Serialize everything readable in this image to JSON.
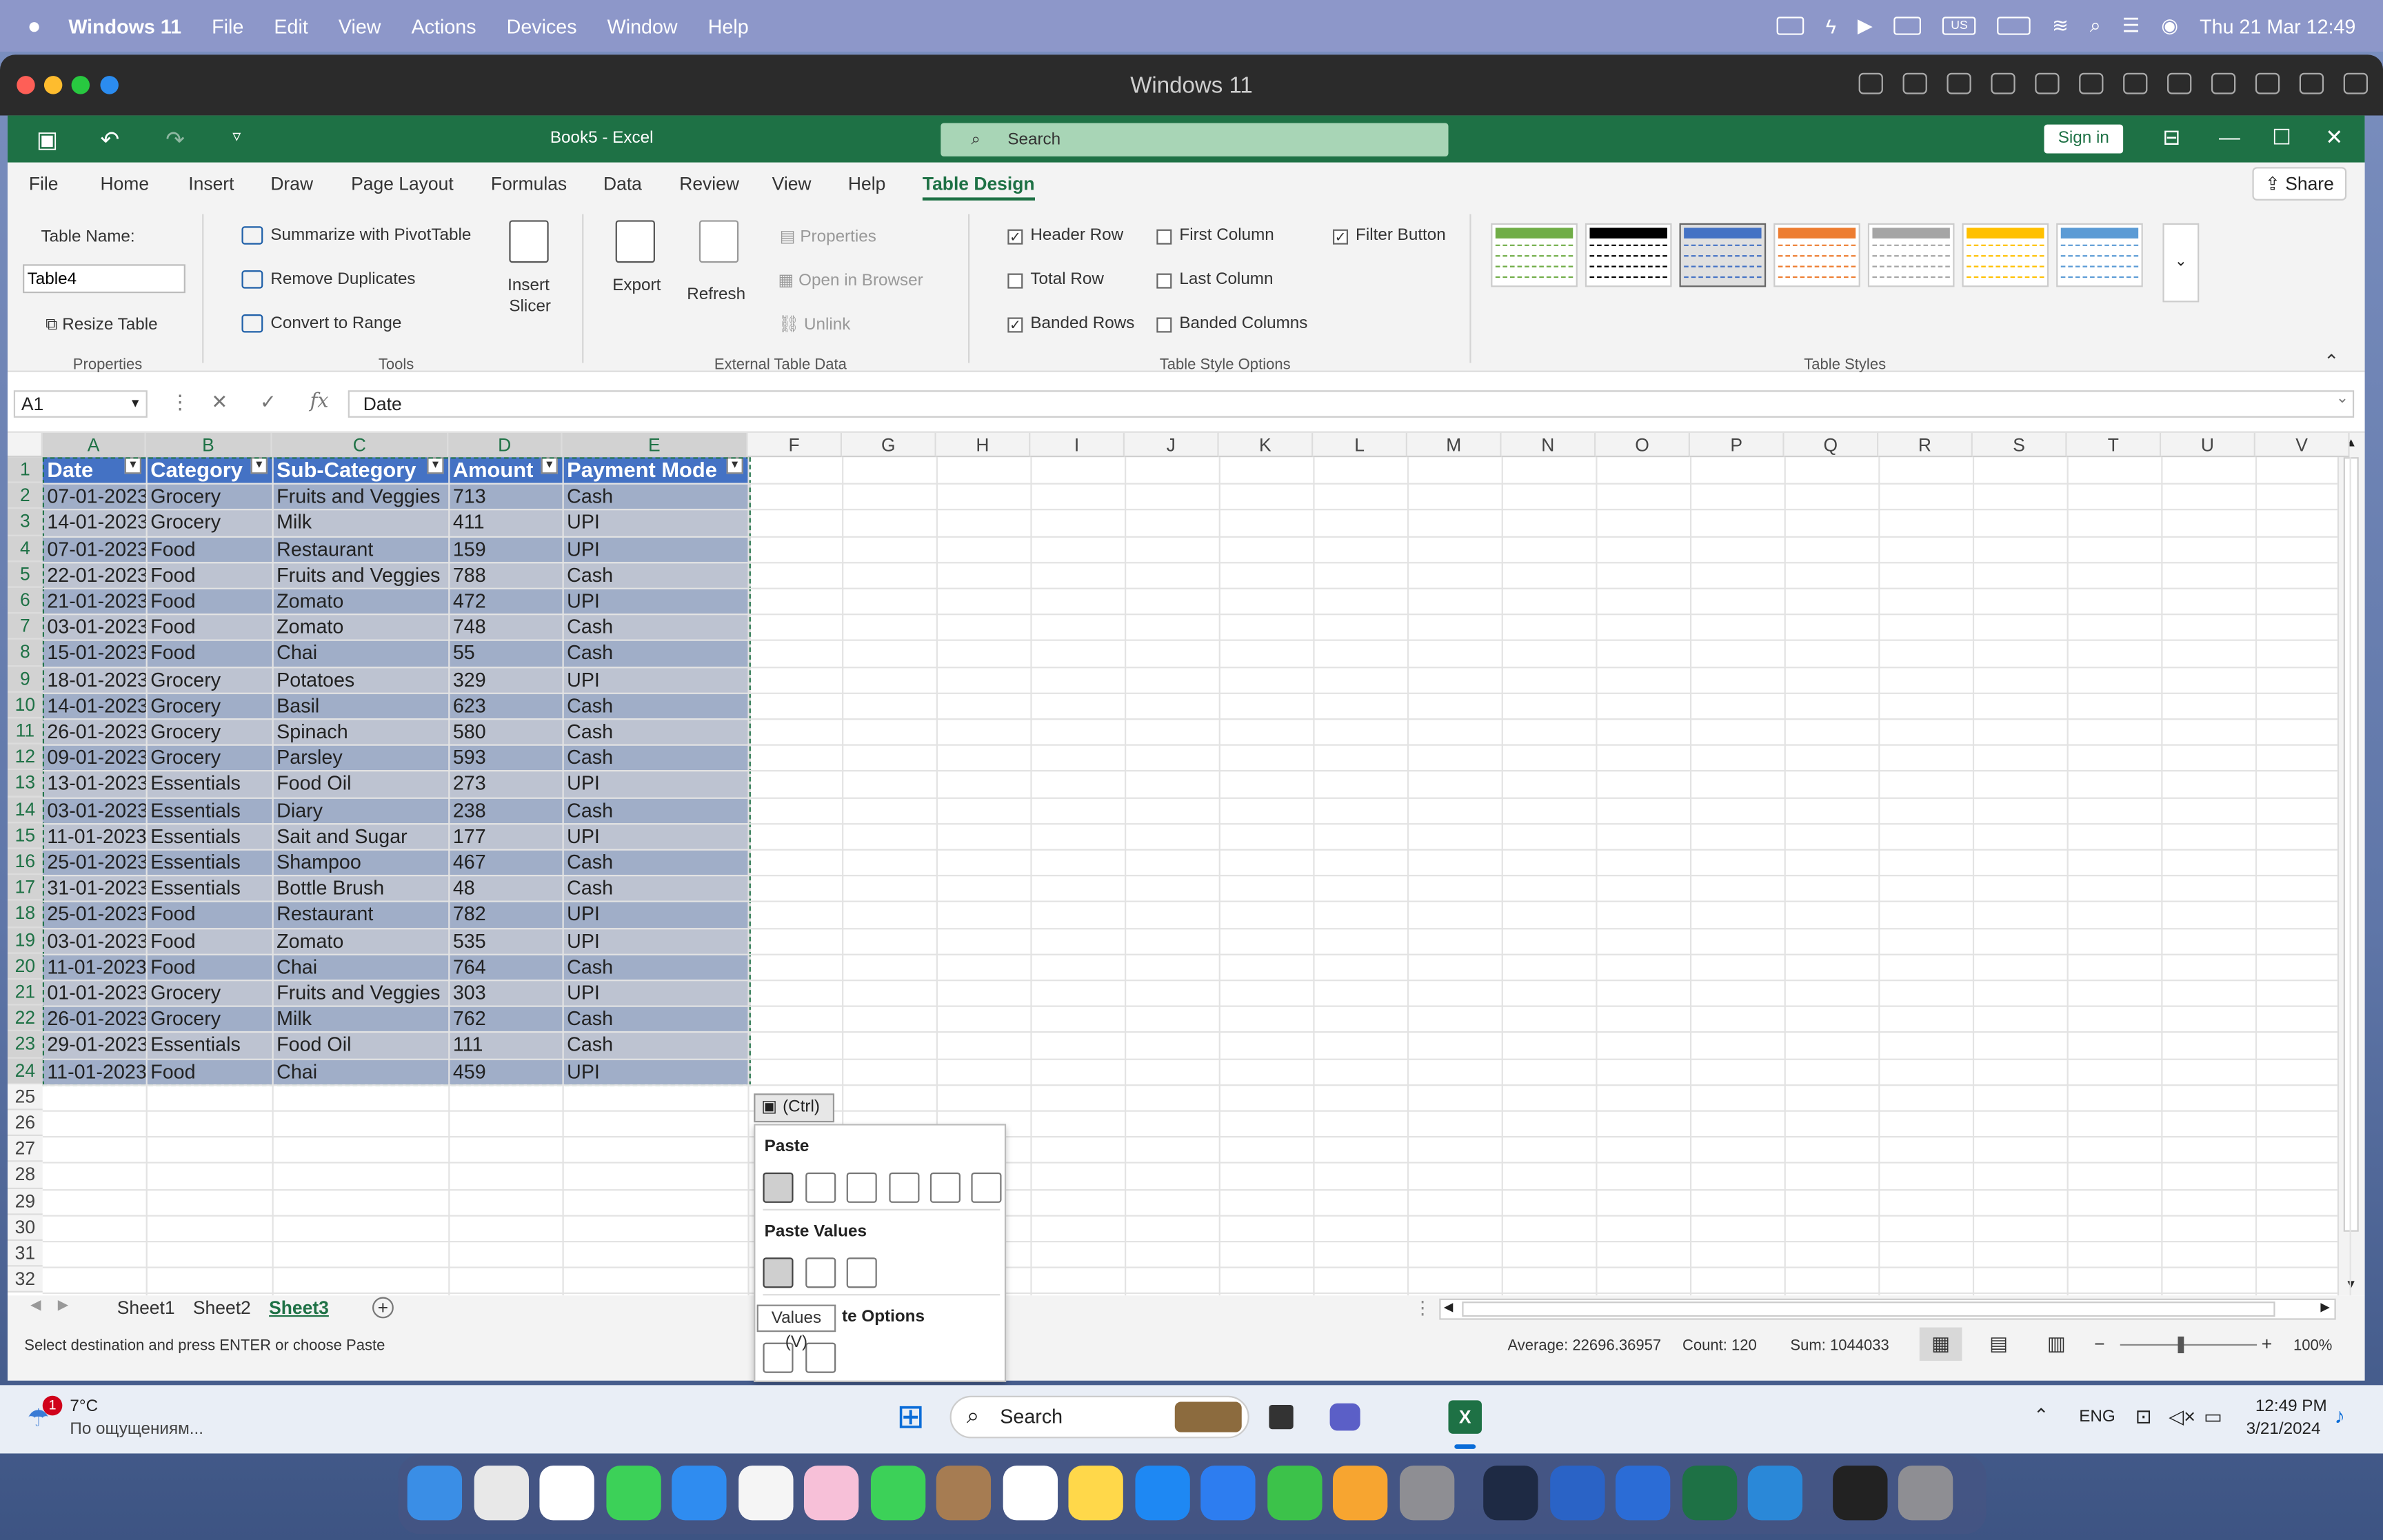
{
  "mac_menu": {
    "app": "Windows 11",
    "items": [
      "File",
      "Edit",
      "View",
      "Actions",
      "Devices",
      "Window",
      "Help"
    ],
    "kb": "US",
    "datetime": "Thu 21 Mar  12:49"
  },
  "vm": {
    "title": "Windows 11"
  },
  "excel": {
    "qat_undo": "↶",
    "qat_redo": "↷",
    "qat_more": "▿",
    "doc_title": "Book5  -  Excel",
    "search_placeholder": "Search",
    "sign_in": "Sign in",
    "tabs": [
      "File",
      "Home",
      "Insert",
      "Draw",
      "Page Layout",
      "Formulas",
      "Data",
      "Review",
      "View",
      "Help",
      "Table Design"
    ],
    "share": "Share",
    "ribbon": {
      "table_name_label": "Table Name:",
      "table_name_value": "Table4",
      "resize_table": "Resize Table",
      "properties_group": "Properties",
      "summarize": "Summarize with PivotTable",
      "remove_duplicates": "Remove Duplicates",
      "convert_to_range": "Convert to Range",
      "tools_group": "Tools",
      "insert_slicer_1": "Insert",
      "insert_slicer_2": "Slicer",
      "export": "Export",
      "refresh": "Refresh",
      "properties": "Properties",
      "open_in_browser": "Open in Browser",
      "unlink": "Unlink",
      "external_group": "External Table Data",
      "options": [
        {
          "label": "Header Row",
          "checked": true
        },
        {
          "label": "Total Row",
          "checked": false
        },
        {
          "label": "Banded Rows",
          "checked": true
        },
        {
          "label": "First Column",
          "checked": false
        },
        {
          "label": "Last Column",
          "checked": false
        },
        {
          "label": "Banded Columns",
          "checked": false
        },
        {
          "label": "Filter Button",
          "checked": true
        }
      ],
      "options_group": "Table Style Options",
      "styles_group": "Table Styles",
      "style_colors": [
        "#70ad47",
        "#000000",
        "#4472c4",
        "#ed7d31",
        "#a5a5a5",
        "#ffc000",
        "#5b9bd5"
      ]
    },
    "name_box": "A1",
    "formula": "Date",
    "columns": [
      "A",
      "B",
      "C",
      "D",
      "E",
      "F",
      "G",
      "H",
      "I",
      "J",
      "K",
      "L",
      "M",
      "N",
      "O",
      "P",
      "Q",
      "R",
      "S",
      "T",
      "U",
      "V"
    ],
    "rows": [
      "1",
      "2",
      "3",
      "4",
      "5",
      "6",
      "7",
      "8",
      "9",
      "10",
      "11",
      "12",
      "13",
      "14",
      "15",
      "16",
      "17",
      "18",
      "19",
      "20",
      "21",
      "22",
      "23",
      "24",
      "25",
      "26",
      "27",
      "28",
      "29",
      "30",
      "31",
      "32"
    ],
    "table_headers": [
      "Date",
      "Category",
      "Sub-Category",
      "Amount",
      "Payment Mode"
    ],
    "table_rows": [
      [
        "07-01-2023",
        "Grocery",
        "Fruits and Veggies",
        "713",
        "Cash"
      ],
      [
        "14-01-2023",
        "Grocery",
        "Milk",
        "411",
        "UPI"
      ],
      [
        "07-01-2023",
        "Food",
        "Restaurant",
        "159",
        "UPI"
      ],
      [
        "22-01-2023",
        "Food",
        "Fruits and Veggies",
        "788",
        "Cash"
      ],
      [
        "21-01-2023",
        "Food",
        "Zomato",
        "472",
        "UPI"
      ],
      [
        "03-01-2023",
        "Food",
        "Zomato",
        "748",
        "Cash"
      ],
      [
        "15-01-2023",
        "Food",
        "Chai",
        "55",
        "Cash"
      ],
      [
        "18-01-2023",
        "Grocery",
        "Potatoes",
        "329",
        "UPI"
      ],
      [
        "14-01-2023",
        "Grocery",
        "Basil",
        "623",
        "Cash"
      ],
      [
        "26-01-2023",
        "Grocery",
        "Spinach",
        "580",
        "Cash"
      ],
      [
        "09-01-2023",
        "Grocery",
        "Parsley",
        "593",
        "Cash"
      ],
      [
        "13-01-2023",
        "Essentials",
        "Food Oil",
        "273",
        "UPI"
      ],
      [
        "03-01-2023",
        "Essentials",
        "Diary",
        "238",
        "Cash"
      ],
      [
        "11-01-2023",
        "Essentials",
        "Sait and Sugar",
        "177",
        "UPI"
      ],
      [
        "25-01-2023",
        "Essentials",
        "Shampoo",
        "467",
        "Cash"
      ],
      [
        "31-01-2023",
        "Essentials",
        "Bottle Brush",
        "48",
        "Cash"
      ],
      [
        "25-01-2023",
        "Food",
        "Restaurant",
        "782",
        "UPI"
      ],
      [
        "03-01-2023",
        "Food",
        "Zomato",
        "535",
        "UPI"
      ],
      [
        "11-01-2023",
        "Food",
        "Chai",
        "764",
        "Cash"
      ],
      [
        "01-01-2023",
        "Grocery",
        "Fruits and Veggies",
        "303",
        "UPI"
      ],
      [
        "26-01-2023",
        "Grocery",
        "Milk",
        "762",
        "Cash"
      ],
      [
        "29-01-2023",
        "Essentials",
        "Food Oil",
        "111",
        "Cash"
      ],
      [
        "11-01-2023",
        "Food",
        "Chai",
        "459",
        "UPI"
      ]
    ],
    "paste_button": "(Ctrl)",
    "paste_menu": {
      "paste": "Paste",
      "paste_values": "Paste Values",
      "other": "te Options",
      "tooltip": "Values (V)"
    },
    "sheets": [
      "Sheet1",
      "Sheet2",
      "Sheet3"
    ],
    "active_sheet": "Sheet3",
    "status": {
      "message": "Select destination and press ENTER or choose Paste",
      "average": "Average: 22696.36957",
      "count": "Count: 120",
      "sum": "Sum: 1044033",
      "zoom": "100%"
    }
  },
  "taskbar": {
    "weather_temp": "7°C",
    "weather_desc": "По ощущениям...",
    "badge": "1",
    "search": "Search",
    "lang": "ENG",
    "time": "12:49 PM",
    "date": "3/21/2024"
  },
  "dock_colors": [
    "#3a8ee6",
    "#e8e8e8",
    "#ffffff",
    "#3cd158",
    "#2f8cf0",
    "#f5f5f5",
    "#f7c0d8",
    "#3cd158",
    "#a67c52",
    "#ffffff",
    "#ffd84a",
    "#1e88f3",
    "#2d7df0",
    "#3cc24a",
    "#f7a530",
    "#8e8e93",
    "#1e2a44",
    "#2a63c6",
    "#2b6cd6",
    "#1e7145",
    "#2a88d8",
    "#222222",
    "#8e8e93"
  ]
}
